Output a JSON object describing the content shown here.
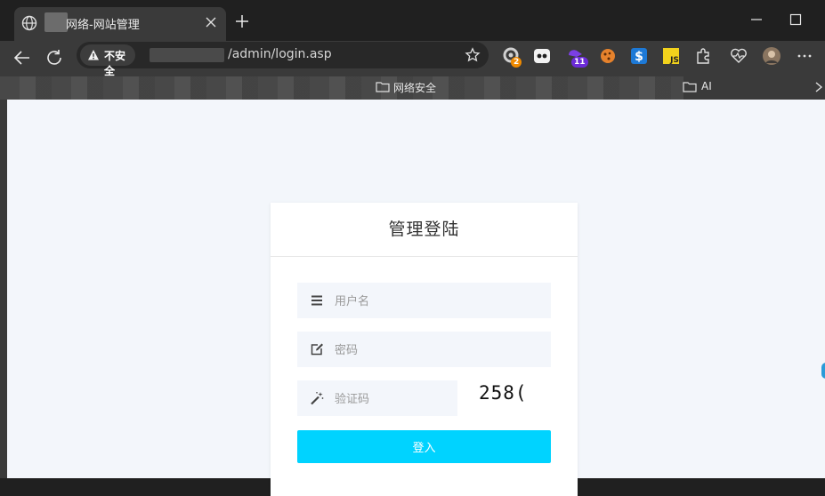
{
  "browser": {
    "tab_title": "网络-网站管理",
    "security_label": "不安全",
    "url_path": "/admin/login.asp",
    "extension_badges": {
      "ext1": "2",
      "ext3": "11"
    },
    "bookmarks": [
      {
        "label": "网络安全"
      },
      {
        "label": "AI"
      }
    ]
  },
  "login": {
    "title": "管理登陆",
    "username_placeholder": "用户名",
    "password_placeholder": "密码",
    "captcha_placeholder": "验证码",
    "captcha_text": "258(",
    "submit_label": "登入"
  },
  "colors": {
    "accent": "#00d3ff",
    "page_bg": "#f3f6fb",
    "chrome_bg": "#202020",
    "toolbar_bg": "#3a3a3a"
  },
  "icons": {
    "favicon": "globe-icon",
    "username": "bars-icon",
    "password": "edit-icon",
    "captcha": "magic-wand-icon"
  }
}
